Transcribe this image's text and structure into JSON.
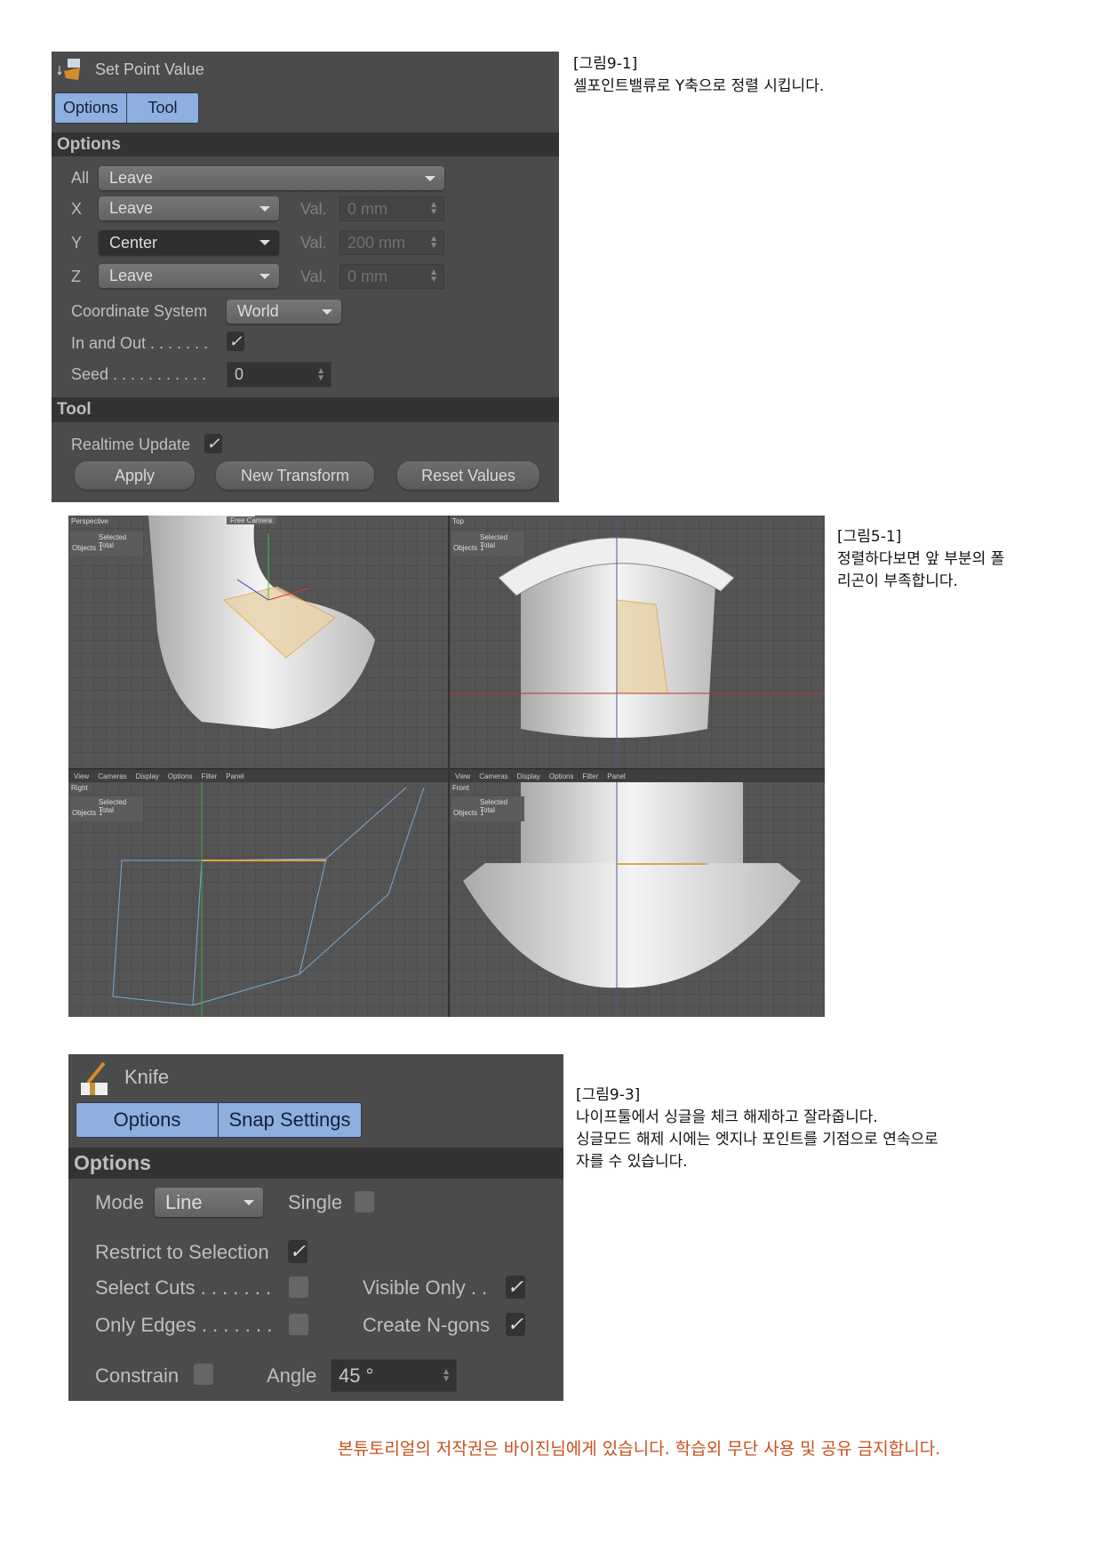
{
  "set_point_panel": {
    "title": "Set Point Value",
    "icon": "set-point-value-icon",
    "tabs": [
      "Options",
      "Tool"
    ],
    "options_header": "Options",
    "all": {
      "label": "All",
      "value": "Leave"
    },
    "x": {
      "label": "X",
      "mode": "Leave",
      "val_label": "Val.",
      "val": "0 mm"
    },
    "y": {
      "label": "Y",
      "mode": "Center",
      "val_label": "Val.",
      "val": "200 mm"
    },
    "z": {
      "label": "Z",
      "mode": "Leave",
      "val_label": "Val.",
      "val": "0 mm"
    },
    "coordinate_system": {
      "label": "Coordinate System",
      "value": "World"
    },
    "in_and_out": {
      "label": "In and Out . . . . . . .",
      "checked": true
    },
    "seed": {
      "label": "Seed . . . . . . . . . . .",
      "value": "0"
    },
    "tool_header": "Tool",
    "realtime_update": {
      "label": "Realtime Update",
      "checked": true
    },
    "buttons": {
      "apply": "Apply",
      "new_transform": "New Transform",
      "reset_values": "Reset Values"
    },
    "check_glyph": "✓"
  },
  "caption1": {
    "fig": "[그림9-1]",
    "text": "셀포인트밸류로 Y축으로 정렬 시킵니다."
  },
  "viewports": {
    "perspective": {
      "name": "Perspective",
      "camera": "Free Camera"
    },
    "top": {
      "name": "Top"
    },
    "right": {
      "name": "Right"
    },
    "front": {
      "name": "Front"
    },
    "hud_title": "Selected Total",
    "hud_objects": "Objects",
    "hud_count": "1",
    "menu": [
      "View",
      "Cameras",
      "Display",
      "Options",
      "Filter",
      "Panel"
    ]
  },
  "caption2": {
    "fig": "[그림5-1]",
    "line1": "정렬하다보면 앞 부분의 폴",
    "line2": "리곤이 부족합니다."
  },
  "knife_panel": {
    "title": "Knife",
    "icon": "knife-icon",
    "tabs": [
      "Options",
      "Snap Settings"
    ],
    "options_header": "Options",
    "mode": {
      "label": "Mode",
      "value": "Line"
    },
    "single": {
      "label": "Single",
      "checked": false
    },
    "restrict": {
      "label": "Restrict to Selection",
      "checked": true
    },
    "select_cuts": {
      "label": "Select Cuts . . . . . . .",
      "checked": false
    },
    "visible_only": {
      "label": "Visible Only . .",
      "checked": true
    },
    "only_edges": {
      "label": "Only Edges . . . . . . .",
      "checked": false
    },
    "create_ngons": {
      "label": "Create N-gons",
      "checked": true
    },
    "constrain": {
      "label": "Constrain",
      "checked": false
    },
    "angle": {
      "label": "Angle",
      "value": "45 °"
    },
    "check_glyph": "✓"
  },
  "caption3": {
    "fig": "[그림9-3]",
    "line1": "나이프툴에서 싱글을 체크 해제하고 잘라줍니다.",
    "line2": "싱글모드 해제 시에는 엣지나 포인트를 기점으로 연속으로",
    "line3": "자를 수 있습니다."
  },
  "footer": {
    "text": "본튜토리얼의 저작권은 바이진님에게 있습니다. 학습외 무단 사용 및 공유 금지합니다.",
    "color": "#c8501e"
  }
}
